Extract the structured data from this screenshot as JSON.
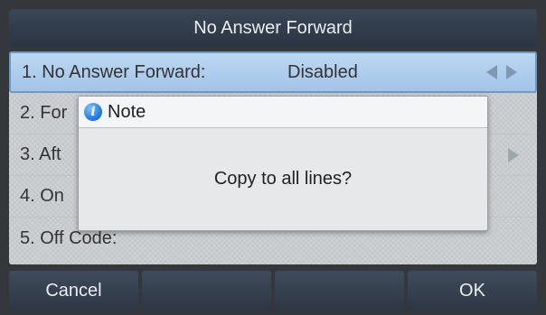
{
  "window": {
    "title": "No Answer Forward"
  },
  "menu": {
    "items": [
      {
        "label": "1. No Answer Forward:",
        "value": "Disabled"
      },
      {
        "label": "2. For",
        "value": ""
      },
      {
        "label": "3. Aft",
        "value": ""
      },
      {
        "label": "4. On",
        "value": ""
      },
      {
        "label": "5. Off Code:",
        "value": ""
      }
    ]
  },
  "dialog": {
    "title": "Note",
    "icon": "info-icon",
    "message": "Copy to all lines?"
  },
  "softkeys": [
    "Cancel",
    "",
    "",
    "OK"
  ],
  "colors": {
    "title_bar": "#2b3442",
    "selected_row": "#a3c4e8",
    "list_background": "#cfd3d6",
    "softkey": "#2d3643"
  }
}
